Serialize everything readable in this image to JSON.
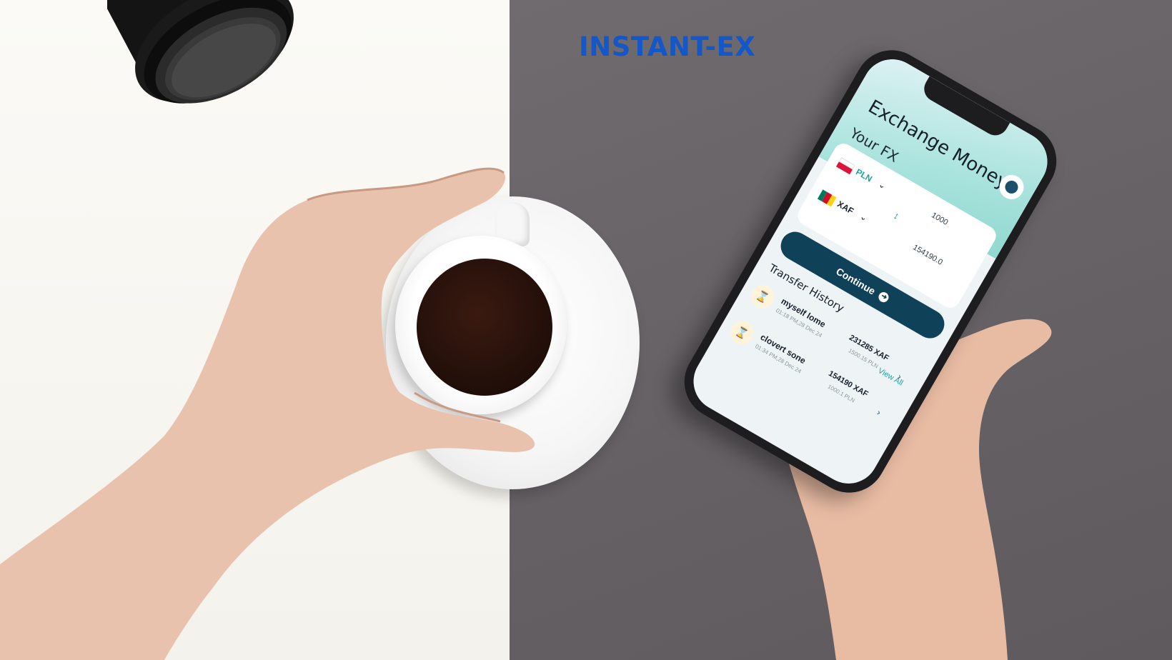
{
  "brand": {
    "name": "INSTANT-EX",
    "color": "#1457c8"
  },
  "app": {
    "title": "Exchange Money",
    "subtitle": "Your FX",
    "profile_icon": "user-icon",
    "from": {
      "currency": "PLN",
      "amount": "1000",
      "flag": "poland-flag"
    },
    "to": {
      "currency": "XAF",
      "amount": "154190.0",
      "flag": "cameroon-flag"
    },
    "swap_icon": "swap-arrows-icon",
    "continue_label": "Continue",
    "history": {
      "title": "Transfer History",
      "view_all": "View All",
      "items": [
        {
          "name": "myself lome",
          "date": "01:18 PM,28 Dec 24",
          "amount": "231285 XAF",
          "source": "1500.15 PLN",
          "status_icon": "hourglass-icon"
        },
        {
          "name": "clovert sone",
          "date": "01:34 PM,28 Dec 24",
          "amount": "154190 XAF",
          "source": "1000.1 PLN",
          "status_icon": "hourglass-icon"
        }
      ]
    }
  },
  "colors": {
    "teal": "#1aa79a",
    "navy": "#0f4159",
    "table_gray": "#67636a"
  }
}
